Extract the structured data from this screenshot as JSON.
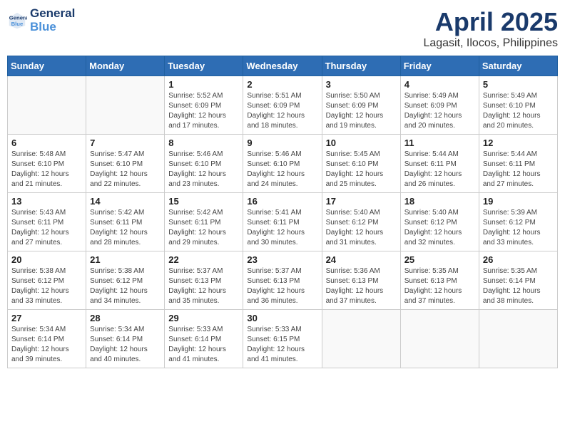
{
  "header": {
    "logo_line1": "General",
    "logo_line2": "Blue",
    "month": "April 2025",
    "location": "Lagasit, Ilocos, Philippines"
  },
  "weekdays": [
    "Sunday",
    "Monday",
    "Tuesday",
    "Wednesday",
    "Thursday",
    "Friday",
    "Saturday"
  ],
  "weeks": [
    [
      {
        "day": "",
        "sunrise": "",
        "sunset": "",
        "daylight": ""
      },
      {
        "day": "",
        "sunrise": "",
        "sunset": "",
        "daylight": ""
      },
      {
        "day": "1",
        "sunrise": "Sunrise: 5:52 AM",
        "sunset": "Sunset: 6:09 PM",
        "daylight": "Daylight: 12 hours and 17 minutes."
      },
      {
        "day": "2",
        "sunrise": "Sunrise: 5:51 AM",
        "sunset": "Sunset: 6:09 PM",
        "daylight": "Daylight: 12 hours and 18 minutes."
      },
      {
        "day": "3",
        "sunrise": "Sunrise: 5:50 AM",
        "sunset": "Sunset: 6:09 PM",
        "daylight": "Daylight: 12 hours and 19 minutes."
      },
      {
        "day": "4",
        "sunrise": "Sunrise: 5:49 AM",
        "sunset": "Sunset: 6:09 PM",
        "daylight": "Daylight: 12 hours and 20 minutes."
      },
      {
        "day": "5",
        "sunrise": "Sunrise: 5:49 AM",
        "sunset": "Sunset: 6:10 PM",
        "daylight": "Daylight: 12 hours and 20 minutes."
      }
    ],
    [
      {
        "day": "6",
        "sunrise": "Sunrise: 5:48 AM",
        "sunset": "Sunset: 6:10 PM",
        "daylight": "Daylight: 12 hours and 21 minutes."
      },
      {
        "day": "7",
        "sunrise": "Sunrise: 5:47 AM",
        "sunset": "Sunset: 6:10 PM",
        "daylight": "Daylight: 12 hours and 22 minutes."
      },
      {
        "day": "8",
        "sunrise": "Sunrise: 5:46 AM",
        "sunset": "Sunset: 6:10 PM",
        "daylight": "Daylight: 12 hours and 23 minutes."
      },
      {
        "day": "9",
        "sunrise": "Sunrise: 5:46 AM",
        "sunset": "Sunset: 6:10 PM",
        "daylight": "Daylight: 12 hours and 24 minutes."
      },
      {
        "day": "10",
        "sunrise": "Sunrise: 5:45 AM",
        "sunset": "Sunset: 6:10 PM",
        "daylight": "Daylight: 12 hours and 25 minutes."
      },
      {
        "day": "11",
        "sunrise": "Sunrise: 5:44 AM",
        "sunset": "Sunset: 6:11 PM",
        "daylight": "Daylight: 12 hours and 26 minutes."
      },
      {
        "day": "12",
        "sunrise": "Sunrise: 5:44 AM",
        "sunset": "Sunset: 6:11 PM",
        "daylight": "Daylight: 12 hours and 27 minutes."
      }
    ],
    [
      {
        "day": "13",
        "sunrise": "Sunrise: 5:43 AM",
        "sunset": "Sunset: 6:11 PM",
        "daylight": "Daylight: 12 hours and 27 minutes."
      },
      {
        "day": "14",
        "sunrise": "Sunrise: 5:42 AM",
        "sunset": "Sunset: 6:11 PM",
        "daylight": "Daylight: 12 hours and 28 minutes."
      },
      {
        "day": "15",
        "sunrise": "Sunrise: 5:42 AM",
        "sunset": "Sunset: 6:11 PM",
        "daylight": "Daylight: 12 hours and 29 minutes."
      },
      {
        "day": "16",
        "sunrise": "Sunrise: 5:41 AM",
        "sunset": "Sunset: 6:11 PM",
        "daylight": "Daylight: 12 hours and 30 minutes."
      },
      {
        "day": "17",
        "sunrise": "Sunrise: 5:40 AM",
        "sunset": "Sunset: 6:12 PM",
        "daylight": "Daylight: 12 hours and 31 minutes."
      },
      {
        "day": "18",
        "sunrise": "Sunrise: 5:40 AM",
        "sunset": "Sunset: 6:12 PM",
        "daylight": "Daylight: 12 hours and 32 minutes."
      },
      {
        "day": "19",
        "sunrise": "Sunrise: 5:39 AM",
        "sunset": "Sunset: 6:12 PM",
        "daylight": "Daylight: 12 hours and 33 minutes."
      }
    ],
    [
      {
        "day": "20",
        "sunrise": "Sunrise: 5:38 AM",
        "sunset": "Sunset: 6:12 PM",
        "daylight": "Daylight: 12 hours and 33 minutes."
      },
      {
        "day": "21",
        "sunrise": "Sunrise: 5:38 AM",
        "sunset": "Sunset: 6:12 PM",
        "daylight": "Daylight: 12 hours and 34 minutes."
      },
      {
        "day": "22",
        "sunrise": "Sunrise: 5:37 AM",
        "sunset": "Sunset: 6:13 PM",
        "daylight": "Daylight: 12 hours and 35 minutes."
      },
      {
        "day": "23",
        "sunrise": "Sunrise: 5:37 AM",
        "sunset": "Sunset: 6:13 PM",
        "daylight": "Daylight: 12 hours and 36 minutes."
      },
      {
        "day": "24",
        "sunrise": "Sunrise: 5:36 AM",
        "sunset": "Sunset: 6:13 PM",
        "daylight": "Daylight: 12 hours and 37 minutes."
      },
      {
        "day": "25",
        "sunrise": "Sunrise: 5:35 AM",
        "sunset": "Sunset: 6:13 PM",
        "daylight": "Daylight: 12 hours and 37 minutes."
      },
      {
        "day": "26",
        "sunrise": "Sunrise: 5:35 AM",
        "sunset": "Sunset: 6:14 PM",
        "daylight": "Daylight: 12 hours and 38 minutes."
      }
    ],
    [
      {
        "day": "27",
        "sunrise": "Sunrise: 5:34 AM",
        "sunset": "Sunset: 6:14 PM",
        "daylight": "Daylight: 12 hours and 39 minutes."
      },
      {
        "day": "28",
        "sunrise": "Sunrise: 5:34 AM",
        "sunset": "Sunset: 6:14 PM",
        "daylight": "Daylight: 12 hours and 40 minutes."
      },
      {
        "day": "29",
        "sunrise": "Sunrise: 5:33 AM",
        "sunset": "Sunset: 6:14 PM",
        "daylight": "Daylight: 12 hours and 41 minutes."
      },
      {
        "day": "30",
        "sunrise": "Sunrise: 5:33 AM",
        "sunset": "Sunset: 6:15 PM",
        "daylight": "Daylight: 12 hours and 41 minutes."
      },
      {
        "day": "",
        "sunrise": "",
        "sunset": "",
        "daylight": ""
      },
      {
        "day": "",
        "sunrise": "",
        "sunset": "",
        "daylight": ""
      },
      {
        "day": "",
        "sunrise": "",
        "sunset": "",
        "daylight": ""
      }
    ]
  ]
}
